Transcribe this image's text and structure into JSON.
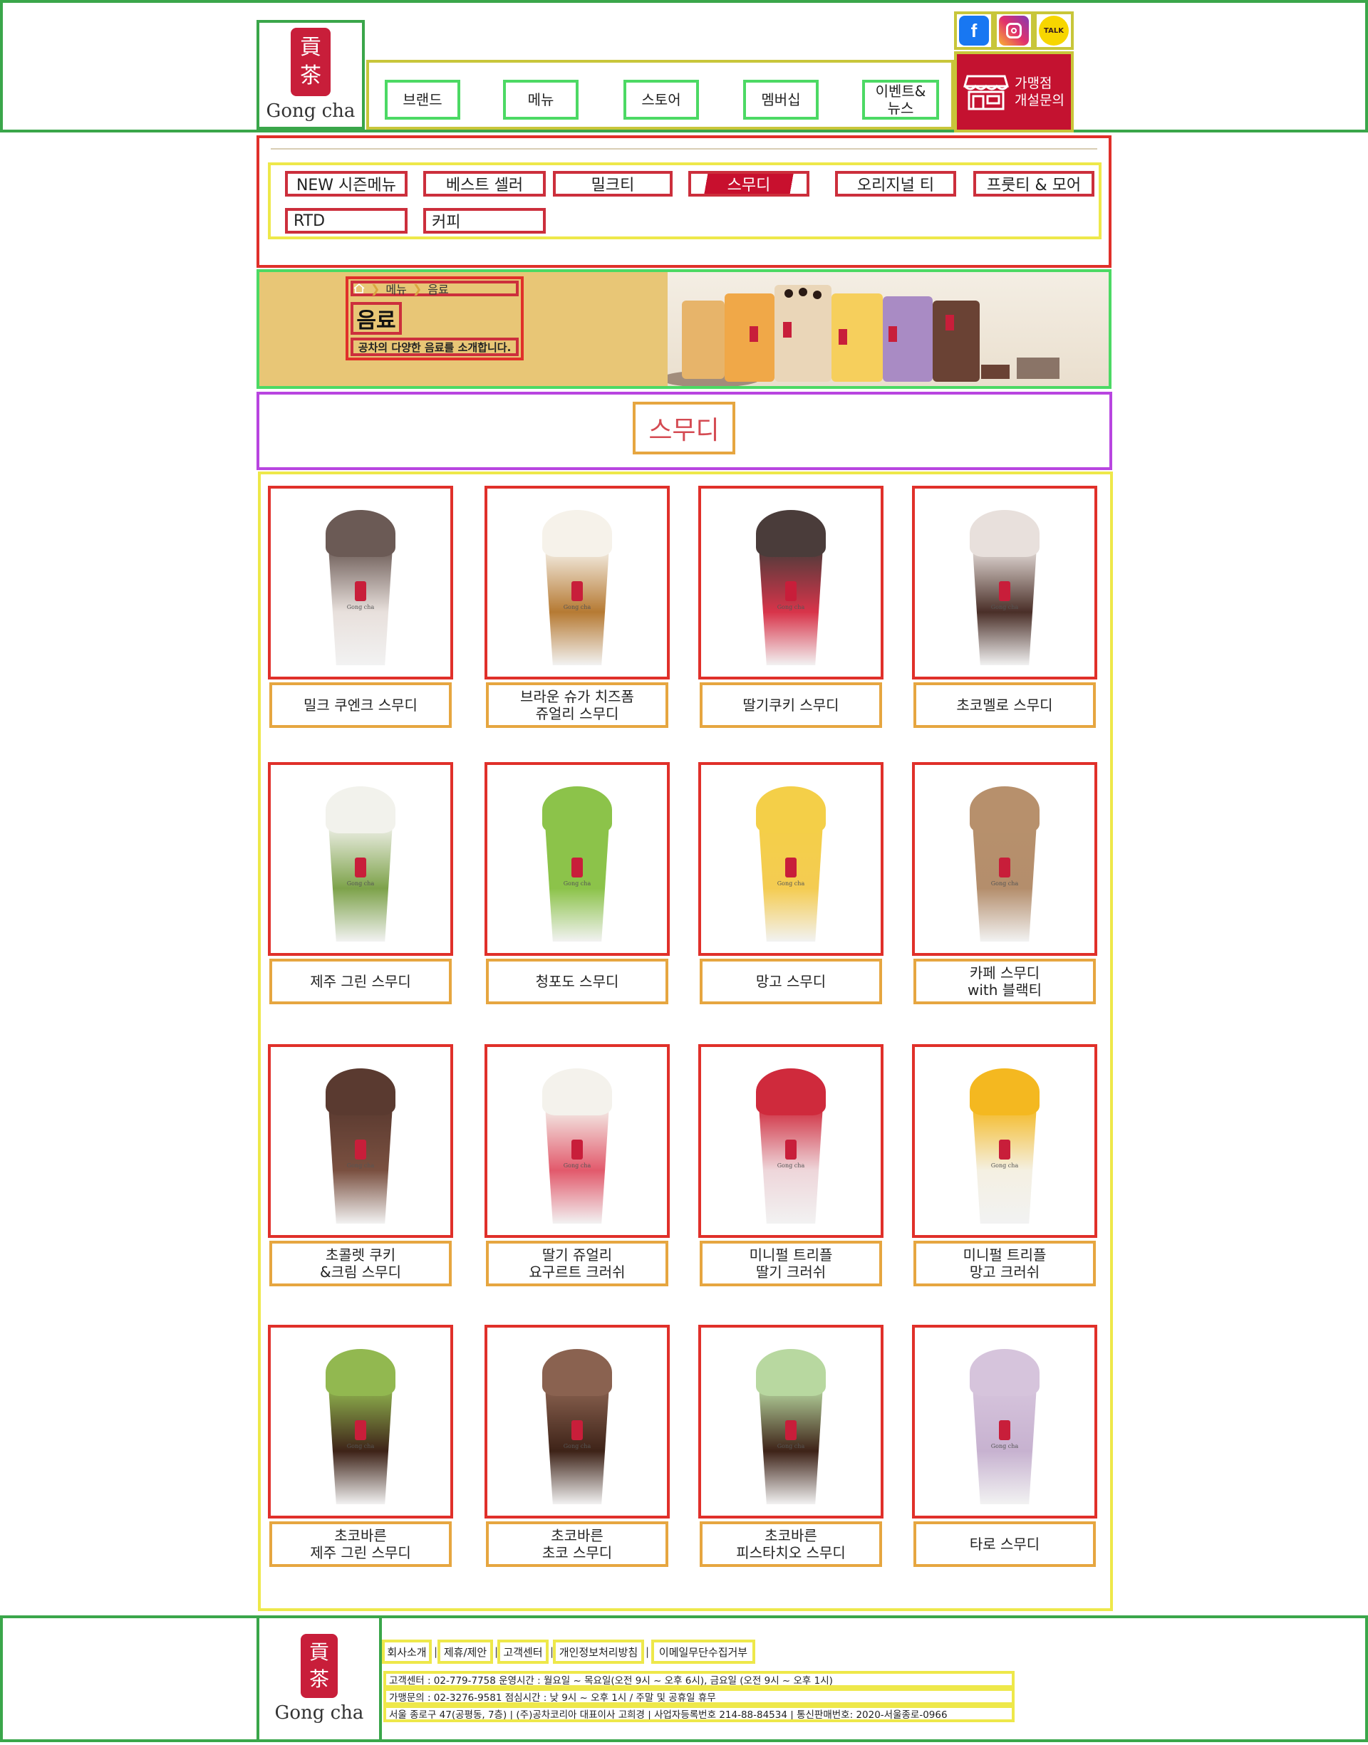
{
  "header": {
    "logo_text": "Gong cha",
    "nav": [
      "브랜드",
      "메뉴",
      "스토어",
      "멤버십",
      "이벤트&\n뉴스"
    ],
    "social": {
      "facebook": "f",
      "instagram": "instagram-icon",
      "kakao": "TALK"
    },
    "franchise_label": "가맹점\n개설문의"
  },
  "categories": [
    "NEW 시즌메뉴",
    "베스트 셀러",
    "밀크티",
    "스무디",
    "오리지널 티",
    "프룻티 & 모어",
    "RTD",
    "커피"
  ],
  "banner": {
    "breadcrumb": [
      "메뉴",
      "음료"
    ],
    "title": "음료",
    "description": "공차의 다양한 음료를 소개합니다."
  },
  "section_title": "스무디",
  "products": [
    {
      "name": "밀크 쿠엔크 스무디",
      "colors": [
        "#6b5a55",
        "#e8e0dc"
      ]
    },
    {
      "name": "브라운 슈가 치즈폼\n쥬얼리 스무디",
      "colors": [
        "#f6f2ea",
        "#b67a33"
      ]
    },
    {
      "name": "딸기쿠키 스무디",
      "colors": [
        "#4a3c3a",
        "#d8344a"
      ]
    },
    {
      "name": "초코멜로 스무디",
      "colors": [
        "#e8e0dc",
        "#4a2f28"
      ]
    },
    {
      "name": "제주 그린 스무디",
      "colors": [
        "#f2f2ec",
        "#7da24a"
      ]
    },
    {
      "name": "청포도 스무디",
      "colors": [
        "#8cc34a",
        "#8cc34a"
      ]
    },
    {
      "name": "망고 스무디",
      "colors": [
        "#f4cf48",
        "#f4cc52"
      ]
    },
    {
      "name": "카페 스무디\nwith 블랙티",
      "colors": [
        "#b7906c",
        "#b48e6c"
      ]
    },
    {
      "name": "초콜렛 쿠키\n&크림 스무디",
      "colors": [
        "#5a3a30",
        "#7a5040"
      ]
    },
    {
      "name": "딸기 쥬얼리\n요구르트 크러쉬",
      "colors": [
        "#f4f2ec",
        "#e25a6c"
      ]
    },
    {
      "name": "미니펄 트리플\n딸기 크러쉬",
      "colors": [
        "#cf2a3c",
        "#eed6da"
      ]
    },
    {
      "name": "미니펄 트리플\n망고 크러쉬",
      "colors": [
        "#f4b820",
        "#f4f0e2"
      ]
    },
    {
      "name": "초코바른\n제주 그린 스무디",
      "colors": [
        "#92b850",
        "#3e2318"
      ]
    },
    {
      "name": "초코바른\n초코 스무디",
      "colors": [
        "#8a6250",
        "#3e2318"
      ]
    },
    {
      "name": "초코바른\n피스타치오 스무디",
      "colors": [
        "#b8d8a0",
        "#3e2318"
      ]
    },
    {
      "name": "타로 스무디",
      "colors": [
        "#d6c4dc",
        "#c7b2d0"
      ]
    }
  ],
  "footer": {
    "logo_text": "Gong cha",
    "links": [
      "회사소개",
      "제휴/제안",
      "고객센터",
      "개인정보처리방침",
      "이메일무단수집거부"
    ],
    "info": [
      "고객센터 : 02-779-7758 운영시간 : 월요일 ~ 목요일(오전 9시 ~ 오후 6시), 금요일 (오전 9시 ~ 오후 1시)",
      "가맹문의 : 02-3276-9581   점심시간 : 낮 9시 ~ 오후 1시 / 주말 및 공휴일 휴무",
      "서울 종로구 47(공평동, 7층) | (주)공차코리아 대표이사 고희경 | 사업자등록번호 214-88-84534 | 통신판매번호: 2020-서울종로-0966"
    ]
  },
  "colors": {
    "brand_red": "#c41230",
    "banner_gold": "#e8c676",
    "section_title": "#d44a52"
  }
}
